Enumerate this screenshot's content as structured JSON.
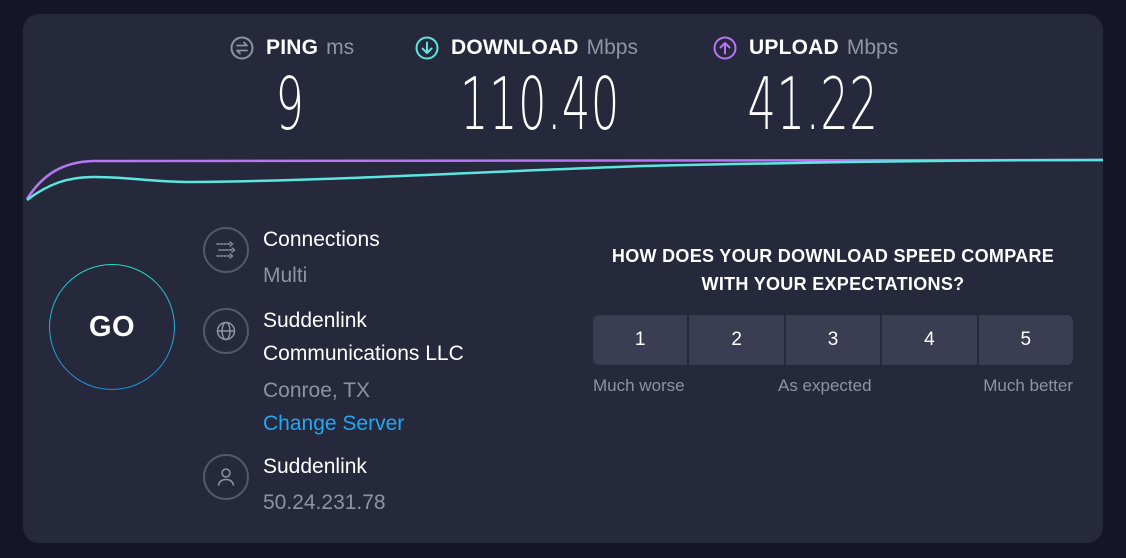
{
  "metrics": {
    "ping": {
      "label": "PING",
      "unit": "ms",
      "value": "9",
      "icon": "ping-arrows-icon"
    },
    "download": {
      "label": "DOWNLOAD",
      "unit": "Mbps",
      "value": "110.40",
      "icon": "download-arrow-icon",
      "color": "#5ce6e0"
    },
    "upload": {
      "label": "UPLOAD",
      "unit": "Mbps",
      "value": "41.22",
      "icon": "upload-arrow-icon",
      "color": "#b776f5"
    }
  },
  "go_button": {
    "label": "GO"
  },
  "connection": {
    "title": "Connections",
    "value": "Multi"
  },
  "server": {
    "name_line1": "Suddenlink",
    "name_line2": "Communications LLC",
    "location": "Conroe, TX",
    "change_label": "Change Server"
  },
  "provider": {
    "name": "Suddenlink",
    "ip": "50.24.231.78"
  },
  "survey": {
    "question_line1": "HOW DOES YOUR DOWNLOAD SPEED COMPARE",
    "question_line2": "WITH YOUR EXPECTATIONS?",
    "options": [
      "1",
      "2",
      "3",
      "4",
      "5"
    ],
    "label_low": "Much worse",
    "label_mid": "As expected",
    "label_high": "Much better"
  },
  "colors": {
    "download_line": "#5ce6e0",
    "upload_line": "#b776f5",
    "link": "#1fa8f5"
  }
}
